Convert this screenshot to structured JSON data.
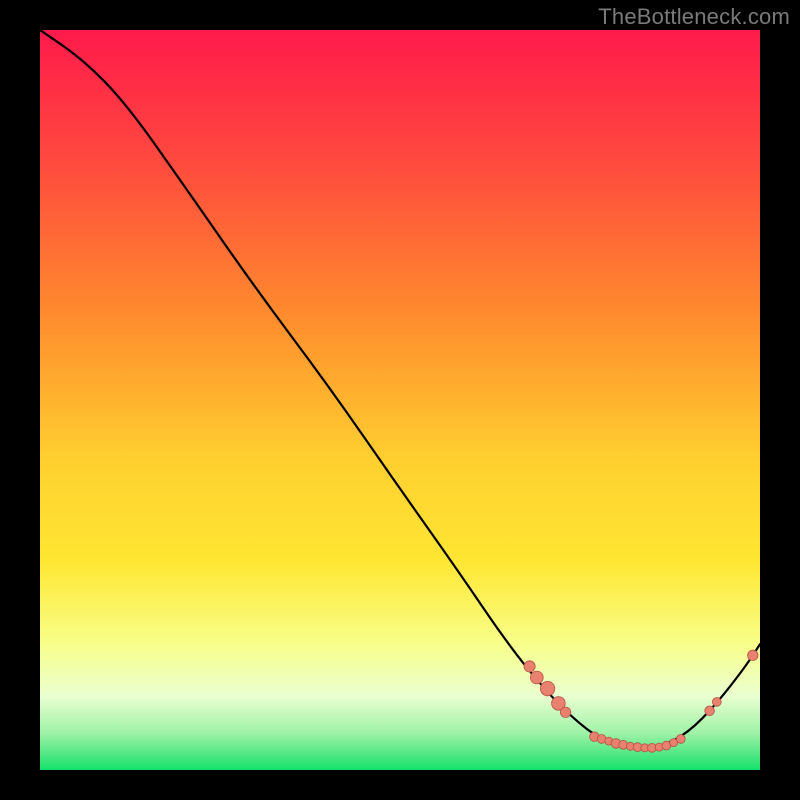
{
  "watermark": "TheBottleneck.com",
  "colors": {
    "background": "#000000",
    "gradient_top": "#ff1a4b",
    "gradient_mid_top": "#ff8a2e",
    "gradient_mid": "#ffe733",
    "gradient_low": "#f6ffb0",
    "gradient_bottom": "#15e06a",
    "curve": "#000000",
    "dot_fill": "#e9816f",
    "dot_stroke": "#b75043",
    "watermark_text": "#7a7a7a"
  },
  "chart_data": {
    "type": "line",
    "title": "",
    "xlabel": "",
    "ylabel": "",
    "xlim": [
      0,
      100
    ],
    "ylim": [
      0,
      100
    ],
    "grid": false,
    "legend": false,
    "curve": [
      {
        "x": 0,
        "y": 100
      },
      {
        "x": 6,
        "y": 96
      },
      {
        "x": 12,
        "y": 90
      },
      {
        "x": 20,
        "y": 79
      },
      {
        "x": 30,
        "y": 65
      },
      {
        "x": 40,
        "y": 52
      },
      {
        "x": 50,
        "y": 38
      },
      {
        "x": 58,
        "y": 27
      },
      {
        "x": 65,
        "y": 17
      },
      {
        "x": 70,
        "y": 11
      },
      {
        "x": 74,
        "y": 7
      },
      {
        "x": 78,
        "y": 4
      },
      {
        "x": 82,
        "y": 3
      },
      {
        "x": 86,
        "y": 3
      },
      {
        "x": 90,
        "y": 5
      },
      {
        "x": 94,
        "y": 9
      },
      {
        "x": 98,
        "y": 14
      },
      {
        "x": 100,
        "y": 17
      }
    ],
    "dots": [
      {
        "x": 68,
        "y": 14,
        "r": 2.8
      },
      {
        "x": 69,
        "y": 12.5,
        "r": 3.2
      },
      {
        "x": 70.5,
        "y": 11,
        "r": 3.6
      },
      {
        "x": 72,
        "y": 9,
        "r": 3.4
      },
      {
        "x": 73,
        "y": 7.8,
        "r": 2.6
      },
      {
        "x": 77,
        "y": 4.5,
        "r": 2.4
      },
      {
        "x": 78,
        "y": 4.2,
        "r": 2.2
      },
      {
        "x": 79,
        "y": 3.9,
        "r": 2.0
      },
      {
        "x": 80,
        "y": 3.6,
        "r": 2.4
      },
      {
        "x": 81,
        "y": 3.4,
        "r": 2.2
      },
      {
        "x": 82,
        "y": 3.2,
        "r": 2.0
      },
      {
        "x": 83,
        "y": 3.1,
        "r": 2.2
      },
      {
        "x": 84,
        "y": 3.0,
        "r": 2.0
      },
      {
        "x": 85,
        "y": 3.0,
        "r": 2.2
      },
      {
        "x": 86,
        "y": 3.1,
        "r": 2.0
      },
      {
        "x": 87,
        "y": 3.3,
        "r": 2.2
      },
      {
        "x": 88,
        "y": 3.7,
        "r": 2.0
      },
      {
        "x": 89,
        "y": 4.2,
        "r": 2.2
      },
      {
        "x": 93,
        "y": 8.0,
        "r": 2.4
      },
      {
        "x": 94,
        "y": 9.2,
        "r": 2.2
      },
      {
        "x": 99,
        "y": 15.5,
        "r": 2.6
      }
    ]
  }
}
